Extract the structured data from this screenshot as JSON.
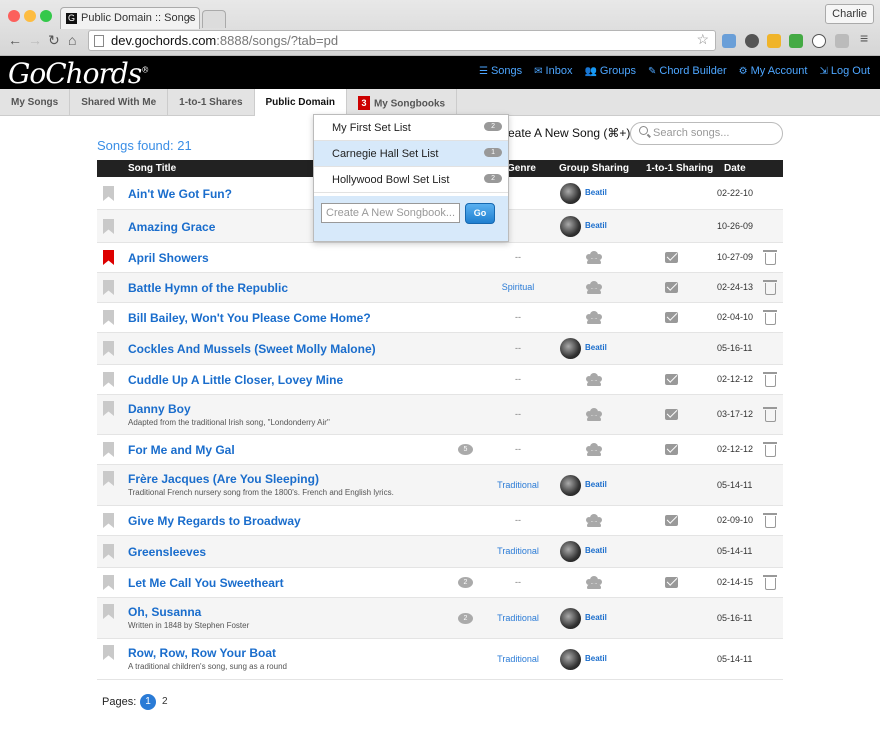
{
  "browser": {
    "tab_title": "Public Domain :: Songs :: G",
    "user": "Charlie",
    "url_domain": "dev.gochords.com",
    "url_rest": ":8888/songs/?tab=pd"
  },
  "brand": {
    "logo": "GoChords"
  },
  "nav": [
    {
      "icon": "list-icon",
      "label": "Songs"
    },
    {
      "icon": "envelope-icon",
      "label": "Inbox"
    },
    {
      "icon": "users-icon",
      "label": "Groups"
    },
    {
      "icon": "wrench-icon",
      "label": "Chord Builder"
    },
    {
      "icon": "gear-icon",
      "label": "My Account"
    },
    {
      "icon": "logout-icon",
      "label": "Log Out"
    }
  ],
  "subtabs": [
    "My Songs",
    "Shared With Me",
    "1-to-1 Shares",
    "Public Domain",
    "My Songbooks"
  ],
  "songbooks_badge": "3",
  "songs_found": "Songs found: 21",
  "create_song": "reate A New Song (⌘+)",
  "search_placeholder": "Search songs...",
  "columns": {
    "title": "Song Title",
    "genre": "Genre",
    "group": "Group Sharing",
    "one": "1-to-1 Sharing",
    "date": "Date"
  },
  "dropdown": {
    "items": [
      {
        "label": "My First Set List",
        "count": "2"
      },
      {
        "label": "Carnegie Hall Set List",
        "count": "1"
      },
      {
        "label": "Hollywood Bowl Set List",
        "count": "2"
      }
    ],
    "new_placeholder": "Create A New Songbook...",
    "go": "Go"
  },
  "songs": [
    {
      "title": "Ain't We Got Fun?",
      "desc": "",
      "genre": "",
      "avatar": "Beatil",
      "date": "02-22-10",
      "bm": false,
      "comments": "",
      "mail": false,
      "trash": false
    },
    {
      "title": "Amazing Grace",
      "desc": "",
      "genre": "",
      "avatar": "Beatil",
      "date": "10-26-09",
      "bm": false,
      "comments": "",
      "mail": false,
      "trash": false
    },
    {
      "title": "April Showers",
      "desc": "",
      "genre": "--",
      "avatar": "",
      "date": "10-27-09",
      "bm": true,
      "comments": "",
      "mail": true,
      "trash": true
    },
    {
      "title": "Battle Hymn of the Republic",
      "desc": "",
      "genre": "Spiritual",
      "avatar": "",
      "date": "02-24-13",
      "bm": false,
      "comments": "",
      "mail": true,
      "trash": true
    },
    {
      "title": "Bill Bailey, Won't You Please Come Home?",
      "desc": "",
      "genre": "--",
      "avatar": "",
      "date": "02-04-10",
      "bm": false,
      "comments": "",
      "mail": true,
      "trash": true
    },
    {
      "title": "Cockles And Mussels (Sweet Molly Malone)",
      "desc": "",
      "genre": "--",
      "avatar": "Beatil",
      "date": "05-16-11",
      "bm": false,
      "comments": "",
      "mail": false,
      "trash": false
    },
    {
      "title": "Cuddle Up A Little Closer, Lovey Mine",
      "desc": "",
      "genre": "--",
      "avatar": "",
      "date": "02-12-12",
      "bm": false,
      "comments": "",
      "mail": true,
      "trash": true
    },
    {
      "title": "Danny Boy",
      "desc": "Adapted from the traditional Irish song, \"Londonderry Air\"",
      "genre": "--",
      "avatar": "",
      "date": "03-17-12",
      "bm": false,
      "comments": "",
      "mail": true,
      "trash": true
    },
    {
      "title": "For Me and My Gal",
      "desc": "",
      "genre": "--",
      "avatar": "",
      "date": "02-12-12",
      "bm": false,
      "comments": "5",
      "mail": true,
      "trash": true
    },
    {
      "title": "Frère Jacques (Are You Sleeping)",
      "desc": "Traditional French nursery song from the 1800's. French and English lyrics.",
      "genre": "Traditional",
      "avatar": "Beatil",
      "date": "05-14-11",
      "bm": false,
      "comments": "",
      "mail": false,
      "trash": false
    },
    {
      "title": "Give My Regards to Broadway",
      "desc": "",
      "genre": "--",
      "avatar": "",
      "date": "02-09-10",
      "bm": false,
      "comments": "",
      "mail": true,
      "trash": true
    },
    {
      "title": "Greensleeves",
      "desc": "",
      "genre": "Traditional",
      "avatar": "Beatil",
      "date": "05-14-11",
      "bm": false,
      "comments": "",
      "mail": false,
      "trash": false
    },
    {
      "title": "Let Me Call You Sweetheart",
      "desc": "",
      "genre": "--",
      "avatar": "",
      "date": "02-14-15",
      "bm": false,
      "comments": "2",
      "mail": true,
      "trash": true
    },
    {
      "title": "Oh, Susanna",
      "desc": "Written in 1848 by Stephen Foster",
      "genre": "Traditional",
      "avatar": "Beatil",
      "date": "05-16-11",
      "bm": false,
      "comments": "2",
      "mail": false,
      "trash": false
    },
    {
      "title": "Row, Row, Row Your Boat",
      "desc": "A traditional children's song, sung as a round",
      "genre": "Traditional",
      "avatar": "Beatil",
      "date": "05-14-11",
      "bm": false,
      "comments": "",
      "mail": false,
      "trash": false
    }
  ],
  "pages_label": "Pages:",
  "page1": "1",
  "page2": "2"
}
